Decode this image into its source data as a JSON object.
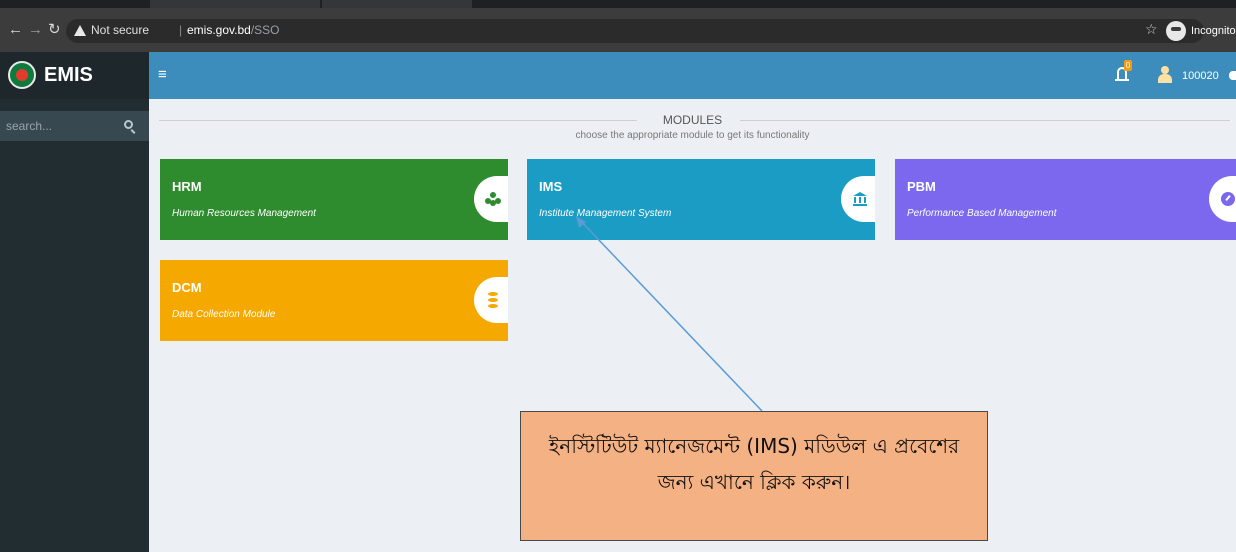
{
  "browser": {
    "secure_label": "Not secure",
    "url_host": "emis.gov.bd",
    "url_path": "/SSO",
    "incognito_label": "Incognito"
  },
  "app": {
    "name": "EMIS",
    "search_placeholder": "search...",
    "username": "100020",
    "notification_count": "0"
  },
  "modules": {
    "heading": "MODULES",
    "subheading": "choose the appropriate module to get its functionality",
    "items": [
      {
        "code": "HRM",
        "name": "Human Resources Management",
        "color": "#2e8b2e",
        "icon": "users-icon"
      },
      {
        "code": "IMS",
        "name": "Institute Management System",
        "color": "#1a9cc4",
        "icon": "institution-icon"
      },
      {
        "code": "PBM",
        "name": "Performance Based Management",
        "color": "#7b68ee",
        "icon": "dashboard-icon"
      },
      {
        "code": "DCM",
        "name": "Data Collection Module",
        "color": "#f5a800",
        "icon": "database-icon"
      }
    ]
  },
  "annotation": {
    "line1": "ইনস্টিটিউট ম্যানেজমেন্ট (IMS) মডিউল এ প্রবেশের",
    "line2": "জন্য এখানে ক্লিক করুন।",
    "fill_color": "#f4b183"
  }
}
